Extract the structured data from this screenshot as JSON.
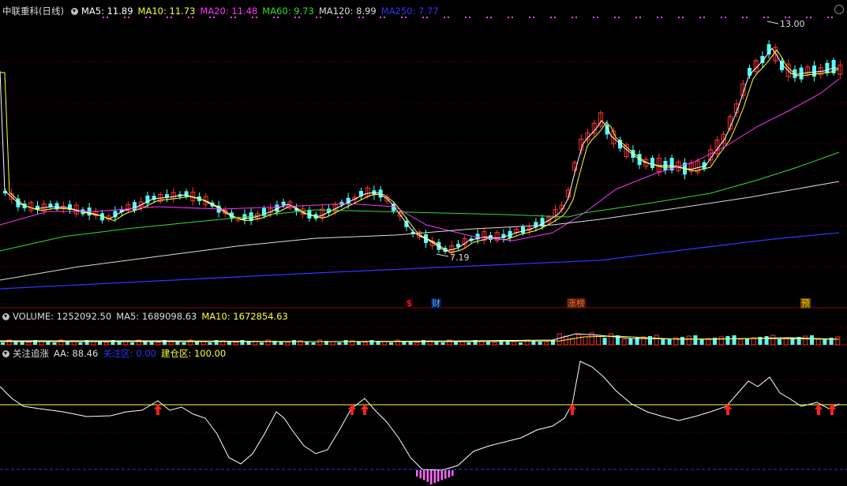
{
  "main": {
    "title": "中联重科(日线)",
    "ma": [
      {
        "label": "MA5: 11.89",
        "color": "#ffffff"
      },
      {
        "label": "MA10: 11.73",
        "color": "#ffff33"
      },
      {
        "label": "MA20: 11.48",
        "color": "#ff33ff"
      },
      {
        "label": "MA60: 9.73",
        "color": "#33dd33"
      },
      {
        "label": "MA120: 8.99",
        "color": "#dddddd"
      },
      {
        "label": "MA250: 7.77",
        "color": "#3333ff"
      }
    ],
    "high_label": "13.00",
    "low_label": "7.19",
    "events": [
      {
        "label": "$",
        "color": "#ff3333"
      },
      {
        "label": "财",
        "color": "#3388ff"
      },
      {
        "label": "涨榜",
        "color": "#ff3333"
      },
      {
        "label": "预",
        "color": "#ffcc00"
      }
    ]
  },
  "volume": {
    "title": "VOLUME: 1252092.50",
    "ma5": "MA5: 1689098.63",
    "ma10": "MA10: 1672854.63"
  },
  "indicator": {
    "title": "关注追涨",
    "aa": "AA: 88.46",
    "attention": "关注区: 0.00",
    "build": "建仓区: 100.00"
  },
  "colors": {
    "up": "#ff3232",
    "down": "#54ffff",
    "ma5": "#ffffff",
    "ma10": "#ffff33",
    "ma20": "#ff33ff",
    "ma60": "#33dd33",
    "ma120": "#dddddd",
    "ma250": "#3333ff",
    "grid": "#800000",
    "arrow": "#ff2020",
    "histogram": "#ff66ff"
  },
  "icons": [
    "dropdown-circle-icon",
    "close-icon",
    "buy-arrow-icon"
  ]
}
